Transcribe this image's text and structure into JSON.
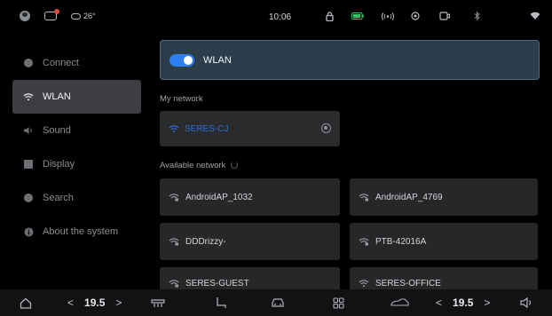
{
  "status_bar": {
    "temperature": "26°",
    "time": "10:06",
    "icons": [
      "avatar-icon",
      "message-icon",
      "cloud-icon",
      "lock-icon",
      "battery-icon",
      "broadcast-icon",
      "target-icon",
      "camera-icon",
      "bluetooth-icon",
      "wifi-icon"
    ],
    "colors": {
      "notification_dot": "#e2463c",
      "battery": "#35c267"
    }
  },
  "sidebar": {
    "items": [
      {
        "label": "Connect",
        "icon": "connect-icon",
        "active": false
      },
      {
        "label": "WLAN",
        "icon": "wifi-icon",
        "active": true
      },
      {
        "label": "Sound",
        "icon": "speaker-icon",
        "active": false
      },
      {
        "label": "Display",
        "icon": "display-icon",
        "active": false
      },
      {
        "label": "Search",
        "icon": "search-icon",
        "active": false
      },
      {
        "label": "About the system",
        "icon": "info-icon",
        "active": false
      }
    ]
  },
  "wlan": {
    "toggle_label": "WLAN",
    "toggle_on": true,
    "my_network_label": "My network",
    "my_network": {
      "ssid": "SERES-CJ"
    },
    "available_label": "Available network",
    "available": [
      {
        "ssid": "AndroidAP_1032",
        "secured": true
      },
      {
        "ssid": "AndroidAP_4769",
        "secured": true
      },
      {
        "ssid": "DDDrizzy-",
        "secured": true
      },
      {
        "ssid": "PTB-42016A",
        "secured": true
      },
      {
        "ssid": "SERES-GUEST",
        "secured": true
      },
      {
        "ssid": "SERES-OFFICE",
        "secured": false
      }
    ],
    "colors": {
      "accent": "#2e7ff0",
      "card_bg": "#2c3d4c"
    }
  },
  "bottom_bar": {
    "left_temp": "19.5",
    "right_temp": "19.5",
    "left_arrow": "<",
    "right_arrow": ">",
    "icons": [
      "home-icon",
      "seat-heat-icon",
      "seat-icon",
      "car-front-icon",
      "apps-grid-icon",
      "car-side-icon",
      "volume-icon"
    ]
  }
}
